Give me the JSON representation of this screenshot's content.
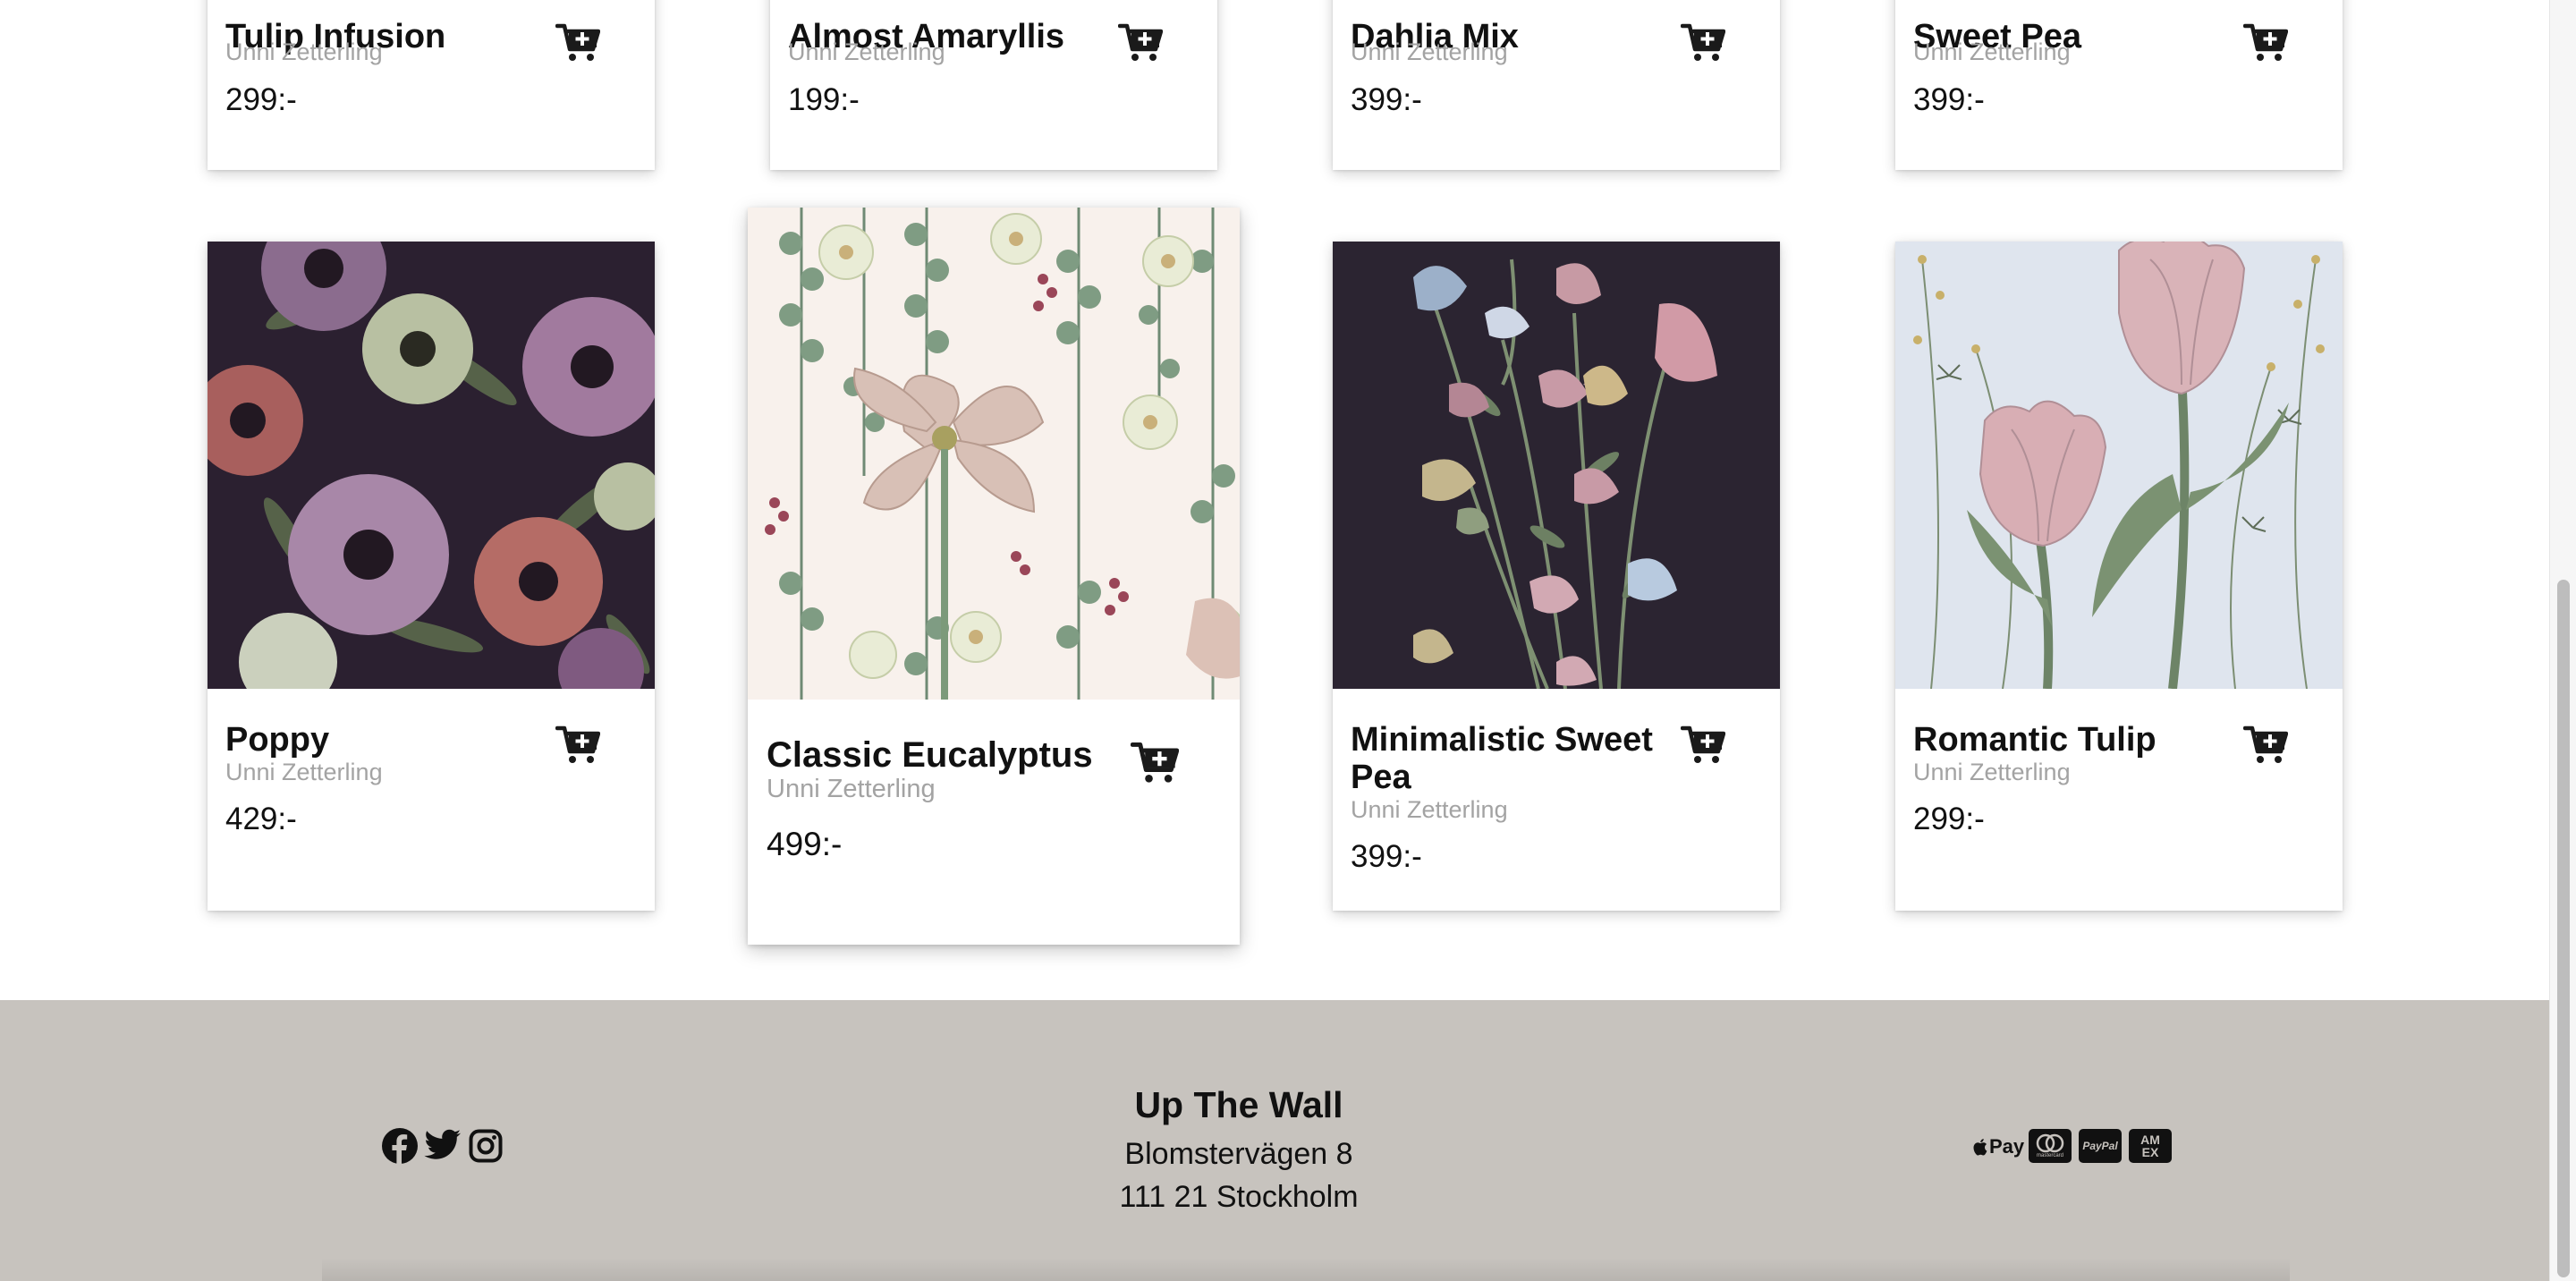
{
  "products_top_row": [
    {
      "title": "Tulip Infusion",
      "artist": "Unni Zetterling",
      "price": "299:-"
    },
    {
      "title": "Almost Amaryllis",
      "artist": "Unni Zetterling",
      "price": "199:-"
    },
    {
      "title": "Dahlia Mix",
      "artist": "Unni Zetterling",
      "price": "399:-"
    },
    {
      "title": "Sweet Pea",
      "artist": "Unni Zetterling",
      "price": "399:-"
    }
  ],
  "products_bottom_row": [
    {
      "title": "Poppy",
      "artist": "Unni Zetterling",
      "price": "429:-"
    },
    {
      "title": "Classic Eucalyptus",
      "artist": "Unni Zetterling",
      "price": "499:-"
    },
    {
      "title_line1": "Minimalistic Sweet",
      "title_line2": "Pea",
      "artist": "Unni Zetterling",
      "price": "399:-"
    },
    {
      "title": "Romantic Tulip",
      "artist": "Unni Zetterling",
      "price": "299:-"
    }
  ],
  "footer": {
    "brand": "Up The Wall",
    "address_line1": "Blomstervägen 8",
    "address_line2": "111 21 Stockholm",
    "social_icons": [
      "facebook-icon",
      "twitter-icon",
      "instagram-icon"
    ],
    "payment_icons": {
      "apple_pay": "Pay",
      "mastercard": "mastercard",
      "paypal": "PayPal",
      "amex": "AM EX"
    }
  },
  "colors": {
    "footer_bg": "#c7c3be",
    "dark_floral_bg": "#2a2030",
    "light_floral_bg": "#f7f1ec",
    "pale_blue_bg": "#dde4ee",
    "text_primary": "#111111",
    "text_muted": "#a3a3a3"
  }
}
